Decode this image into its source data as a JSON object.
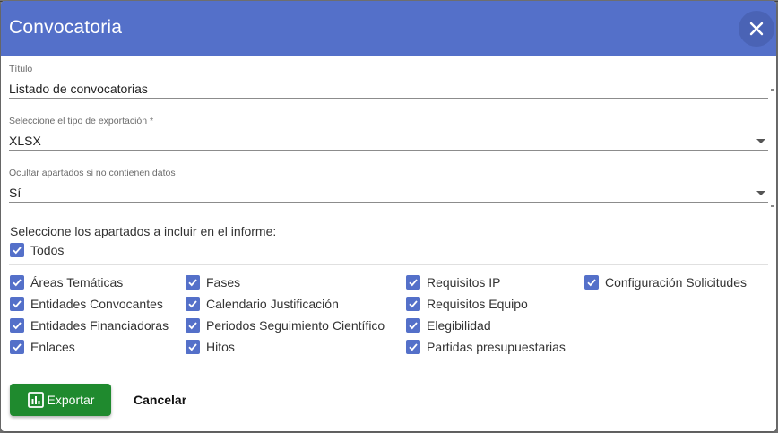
{
  "dialog": {
    "title": "Convocatoria",
    "close_icon": "close-icon",
    "header_color": "#5470c9"
  },
  "fields": {
    "titulo": {
      "label": "Título",
      "value": "Listado de convocatorias"
    },
    "tipo_exportacion": {
      "label": "Seleccione el tipo de exportación *",
      "value": "XLSX"
    },
    "ocultar_apartados": {
      "label": "Ocultar apartados si no contienen datos",
      "value": "Sí"
    }
  },
  "sections": {
    "heading": "Seleccione los apartados a incluir en el informe:",
    "all_label": "Todos",
    "items": [
      "Áreas Temáticas",
      "Entidades Convocantes",
      "Entidades Financiadoras",
      "Enlaces",
      "Fases",
      "Calendario Justificación",
      "Periodos Seguimiento Científico",
      "Hitos",
      "Requisitos IP",
      "Requisitos Equipo",
      "Elegibilidad",
      "Partidas presupuestarias",
      "Configuración Solicitudes"
    ]
  },
  "actions": {
    "export_label": "Exportar",
    "export_icon": "chart-icon",
    "export_color": "#1f8a2e",
    "cancel_label": "Cancelar"
  }
}
